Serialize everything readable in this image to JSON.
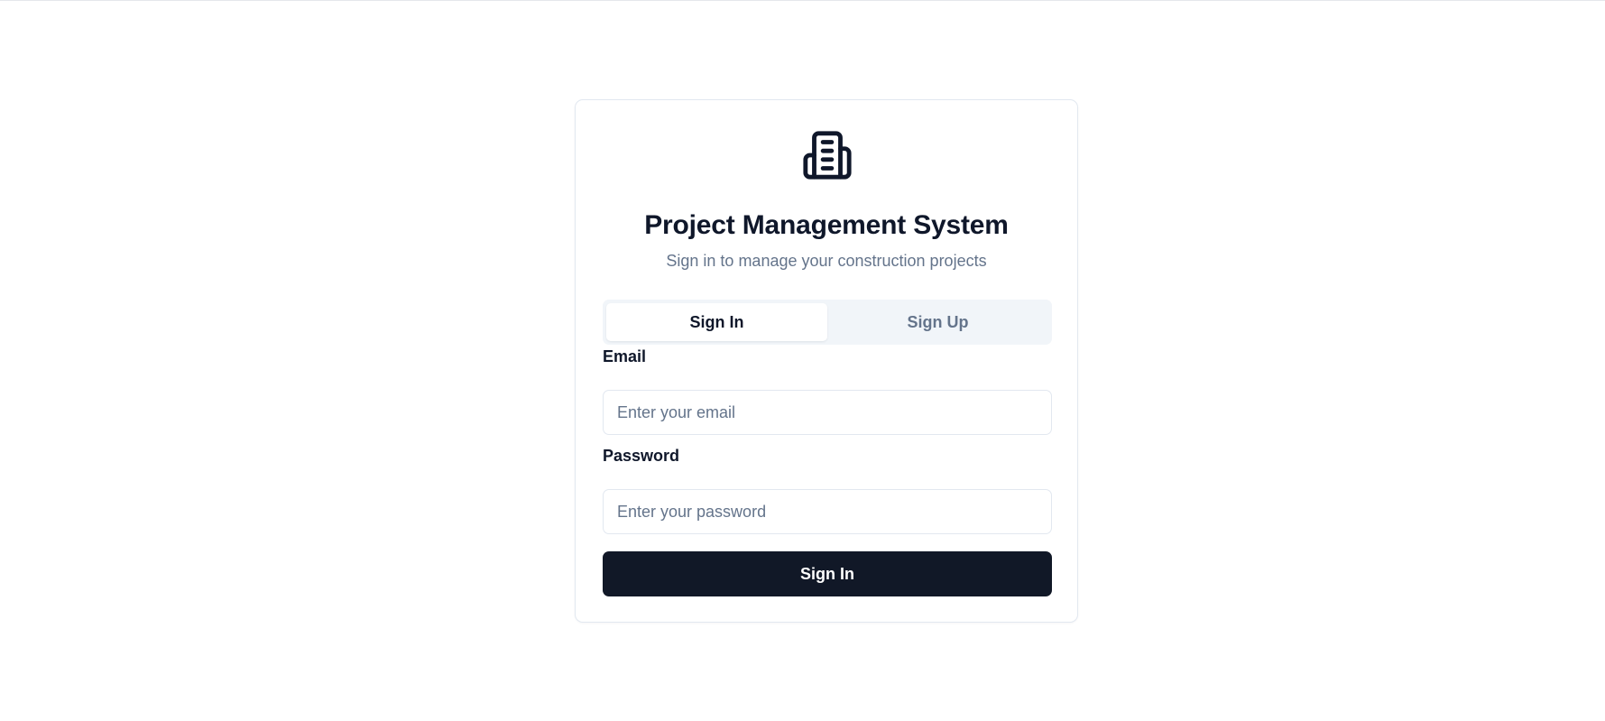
{
  "app": {
    "logo_icon": "building-icon",
    "title": "Project Management System",
    "subtitle": "Sign in to manage your construction projects"
  },
  "tabs": [
    {
      "label": "Sign In",
      "active": true
    },
    {
      "label": "Sign Up",
      "active": false
    }
  ],
  "form": {
    "email_label": "Email",
    "email_placeholder": "Enter your email",
    "email_value": "",
    "password_label": "Password",
    "password_placeholder": "Enter your password",
    "password_value": "",
    "submit_label": "Sign In"
  },
  "colors": {
    "primary": "#111827",
    "muted_text": "#64748b",
    "tab_background": "#f1f5f9",
    "border": "#e2e8f0"
  }
}
